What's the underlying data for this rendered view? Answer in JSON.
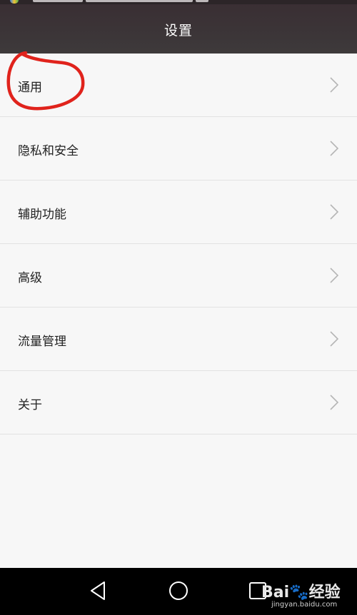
{
  "header": {
    "title": "设置"
  },
  "menu": {
    "items": [
      {
        "label": "通用",
        "icon": "chevron-right-icon"
      },
      {
        "label": "隐私和安全",
        "icon": "chevron-right-icon"
      },
      {
        "label": "辅助功能",
        "icon": "chevron-right-icon"
      },
      {
        "label": "高级",
        "icon": "chevron-right-icon"
      },
      {
        "label": "流量管理",
        "icon": "chevron-right-icon"
      },
      {
        "label": "关于",
        "icon": "chevron-right-icon"
      }
    ]
  },
  "annotation": {
    "color": "#e0231c",
    "target": "通用"
  },
  "navbar": {
    "buttons": [
      "back-icon",
      "home-icon",
      "recents-icon"
    ]
  },
  "watermark": {
    "brand": "Bai",
    "brand_suffix": "经验",
    "url": "jingyan.baidu.com"
  },
  "colors": {
    "header_bg": "#3b3437",
    "list_bg": "#f7f7f7",
    "divider": "#e2e2e2",
    "chevron": "#b5b5b5",
    "nav_bg": "#000000"
  }
}
